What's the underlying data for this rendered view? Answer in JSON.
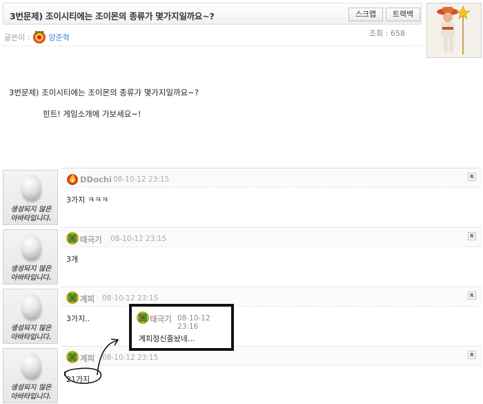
{
  "post": {
    "title": "3번문제) 조이시티에는 조이몬의 종류가 몇가지일까요~?",
    "scrap_label": "스크랩",
    "trackback_label": "트랙백",
    "views_label": "조회 :",
    "views": "658",
    "author_label": "글쓴이 :",
    "author": "양준혁",
    "body": "3번문제) 조이시티에는 조이몬의 종류가 몇가지일까요~?",
    "hint": "힌트! 게임소개에 가보세요~!"
  },
  "comments": [
    {
      "nick": "DDochi",
      "date": "08-10-12 23:15",
      "text": "3가지 ㅋㅋㅋ",
      "avatar_caption_1": "생성되지 않은",
      "avatar_caption_2": "아바타입니다.",
      "reply": "R"
    },
    {
      "nick": "태극기",
      "date": "08-10-12 23:15",
      "text": "3개",
      "avatar_caption_1": "생성되지 않은",
      "avatar_caption_2": "아바타입니다.",
      "reply": "R"
    },
    {
      "nick": "계피",
      "date": "08-10-12 23:15",
      "text": "3가지..",
      "avatar_caption_1": "생성되지 않은",
      "avatar_caption_2": "아바타입니다.",
      "reply": "R"
    },
    {
      "nick": "계피",
      "date": "08-10-12 23:15",
      "text": "21가지",
      "avatar_caption_1": "생성되지 않은",
      "avatar_caption_2": "아바타입니다.",
      "reply": "R"
    }
  ],
  "overlay": {
    "nick": "태극기",
    "date": "08-10-12 23:16",
    "text": "계피정신줄놨네..."
  },
  "colors": {
    "author_link": "#3b84d9",
    "nick_gray": "#a0a0a0",
    "annotation": "#111111"
  }
}
